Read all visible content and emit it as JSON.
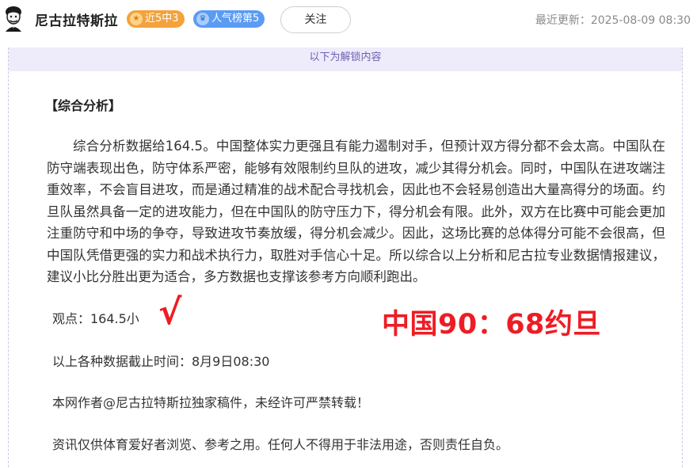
{
  "header": {
    "author_name": "尼古拉特斯拉",
    "badges": {
      "record": {
        "icon": "star-icon",
        "label": "近5中3",
        "color": "#f4a23b"
      },
      "rank": {
        "icon": "crown-icon",
        "label": "人气榜第5",
        "color": "#5a9bf4"
      }
    },
    "follow_label": "关注",
    "update_label": "最近更新：",
    "update_time": "2025-08-09 08:30"
  },
  "content": {
    "unlock_notice": "以下为解锁内容",
    "section_title": "【综合分析】",
    "analysis": "综合分析数据给164.5。中国整体实力更强且有能力遏制对手，但预计双方得分都不会太高。中国队在防守端表现出色，防守体系严密，能够有效限制约旦队的进攻，减少其得分机会。同时，中国队在进攻端注重效率，不会盲目进攻，而是通过精准的战术配合寻找机会，因此也不会轻易创造出大量高得分的场面。约旦队虽然具备一定的进攻能力，但在中国队的防守压力下，得分机会有限。此外，双方在比赛中可能会更加注重防守和中场的争夺，导致进攻节奏放缓，得分机会减少。因此，这场比赛的总体得分可能不会很高，但中国队凭借更强的实力和战术执行力，取胜对手信心十足。所以综合以上分析和尼古拉专业数据情报建议，建议小比分胜出更为适合，多方数据也支撑该参考方向顺利跑出。",
    "viewpoint": "观点：164.5小",
    "check_mark": "√",
    "final_score": "中国90：68约旦",
    "data_cutoff": "以上各种数据截止时间：8月9日08:30",
    "copyright": "本网作者@尼古拉特斯拉独家稿件，未经许可严禁转载！",
    "disclaimer": "资讯仅供体育爱好者浏览、参考之用。任何人不得用于非法用途，否则责任自负。"
  },
  "colors": {
    "highlight_red": "#ee1c24",
    "unlock_bg": "#eeebfb"
  }
}
